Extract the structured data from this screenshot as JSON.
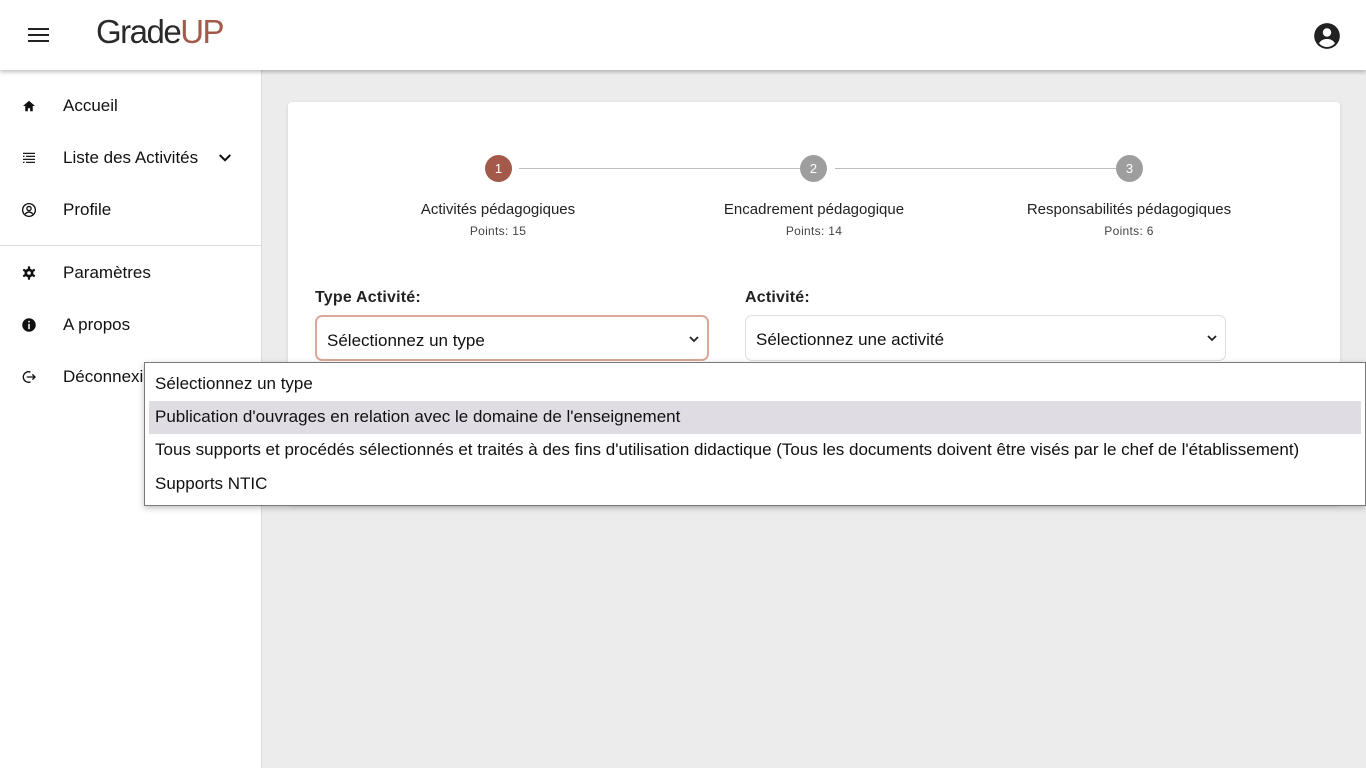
{
  "header": {
    "logo_main": "Grade",
    "logo_accent": "UP"
  },
  "sidebar": {
    "items": [
      {
        "label": "Accueil",
        "icon": "home-icon"
      },
      {
        "label": "Liste des Activités",
        "icon": "list-icon"
      },
      {
        "label": "Profile",
        "icon": "account-circle-icon"
      },
      {
        "label": "Paramètres",
        "icon": "gear-icon"
      },
      {
        "label": "A propos",
        "icon": "info-icon"
      },
      {
        "label": "Déconnexion",
        "icon": "logout-icon"
      }
    ]
  },
  "stepper": {
    "steps": [
      {
        "number": "1",
        "title": "Activités pédagogiques",
        "points": "Points: 15",
        "active": true
      },
      {
        "number": "2",
        "title": "Encadrement pédagogique",
        "points": "Points: 14",
        "active": false
      },
      {
        "number": "3",
        "title": "Responsabilités pédagogiques",
        "points": "Points: 6",
        "active": false
      }
    ]
  },
  "form": {
    "type_label": "Type Activité:",
    "type_value": "Sélectionnez un type",
    "activity_label": "Activité:",
    "activity_value": "Sélectionnez une activité"
  },
  "dropdown": {
    "options": [
      "Sélectionnez un type",
      "Publication d'ouvrages en relation avec le domaine de l'enseignement",
      "Tous supports et procédés sélectionnés et traités à des fins d'utilisation didactique (Tous les documents doivent être visés par le chef de l'établissement)",
      "Supports NTIC"
    ],
    "highlighted_index": 1
  },
  "colors": {
    "accent": "#a35a4a",
    "inactive_step": "#9e9e9e",
    "focus_border": "#d9a898"
  }
}
